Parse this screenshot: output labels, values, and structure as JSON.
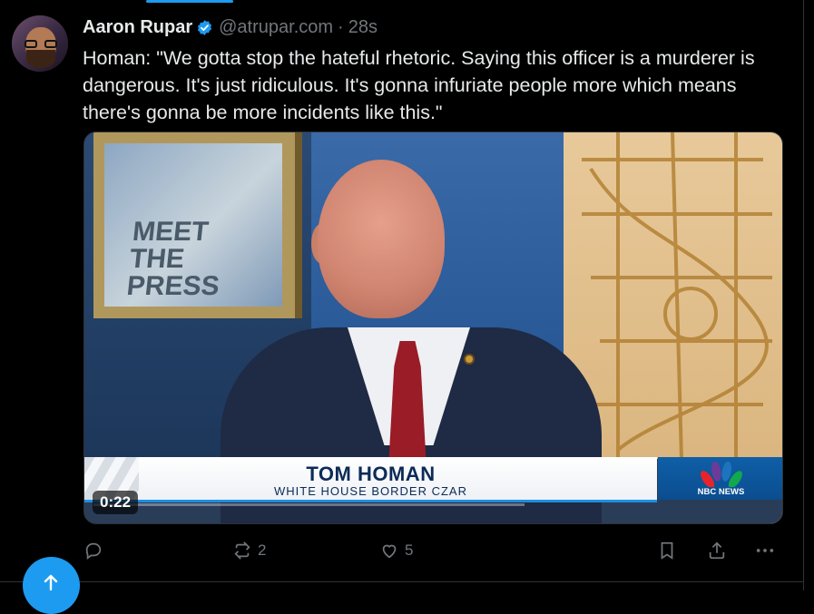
{
  "author": {
    "name": "Aaron Rupar",
    "handle": "@atrupar.com",
    "separator": "·",
    "time": "28s"
  },
  "tweet": {
    "text": "Homan: \"We gotta stop the hateful rhetoric. Saying this officer is a murderer is dangerous. It's just ridiculous. It's gonna infuriate people more which means there's gonna be more incidents like this.\""
  },
  "video": {
    "duration": "0:22",
    "show_logo": "MEET THE PRESS",
    "lower_third_name": "TOM HOMAN",
    "lower_third_title": "WHITE HOUSE BORDER CZAR",
    "network": "NBC NEWS"
  },
  "actions": {
    "reposts": "2",
    "likes": "5"
  },
  "colors": {
    "accent": "#1d9bf0",
    "muted": "#71767b",
    "text": "#e7e9ea",
    "background": "#000000"
  }
}
